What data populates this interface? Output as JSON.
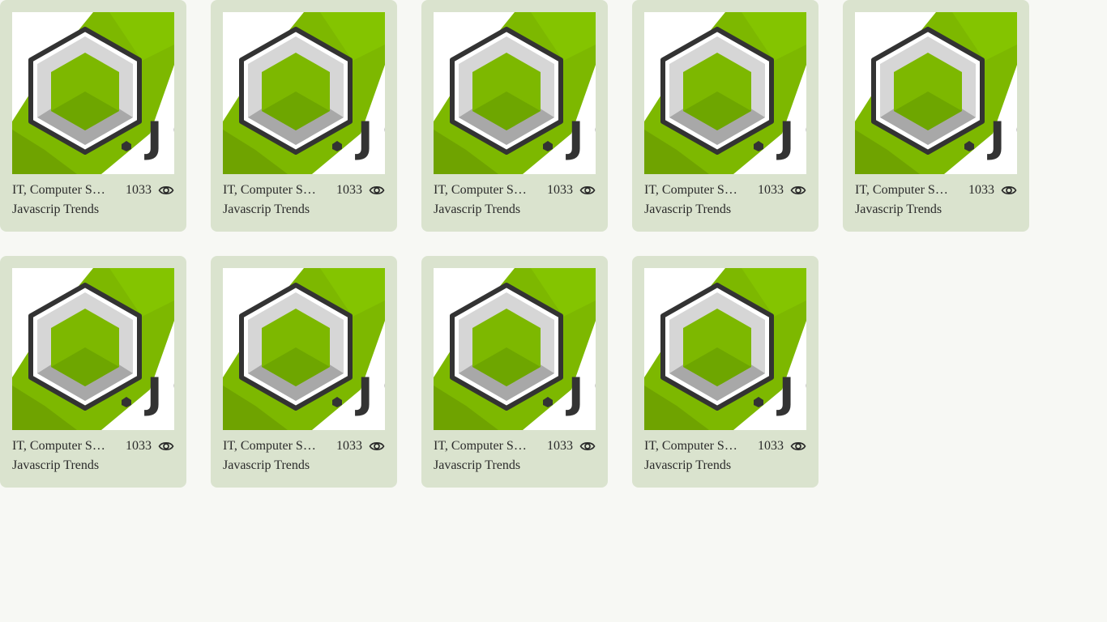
{
  "colors": {
    "page_background": "#f7f8f4",
    "card_background": "#dae3ce",
    "brand_green": "#7db800",
    "text": "#2a2a2a"
  },
  "icons": {
    "views": "eye-icon",
    "thumbnail": "js-hexagon-logo"
  },
  "cards": [
    {
      "category": "IT, Computer Science",
      "views": "1033",
      "title": "Javascrip Trends"
    },
    {
      "category": "IT, Computer Science",
      "views": "1033",
      "title": "Javascrip Trends"
    },
    {
      "category": "IT, Computer Science",
      "views": "1033",
      "title": "Javascrip Trends"
    },
    {
      "category": "IT, Computer Science",
      "views": "1033",
      "title": "Javascrip Trends"
    },
    {
      "category": "IT, Computer Science",
      "views": "1033",
      "title": "Javascrip Trends"
    },
    {
      "category": "IT, Computer Science",
      "views": "1033",
      "title": "Javascrip Trends"
    },
    {
      "category": "IT, Computer Science",
      "views": "1033",
      "title": "Javascrip Trends"
    },
    {
      "category": "IT, Computer Science",
      "views": "1033",
      "title": "Javascrip Trends"
    },
    {
      "category": "IT, Computer Science",
      "views": "1033",
      "title": "Javascrip Trends"
    }
  ]
}
